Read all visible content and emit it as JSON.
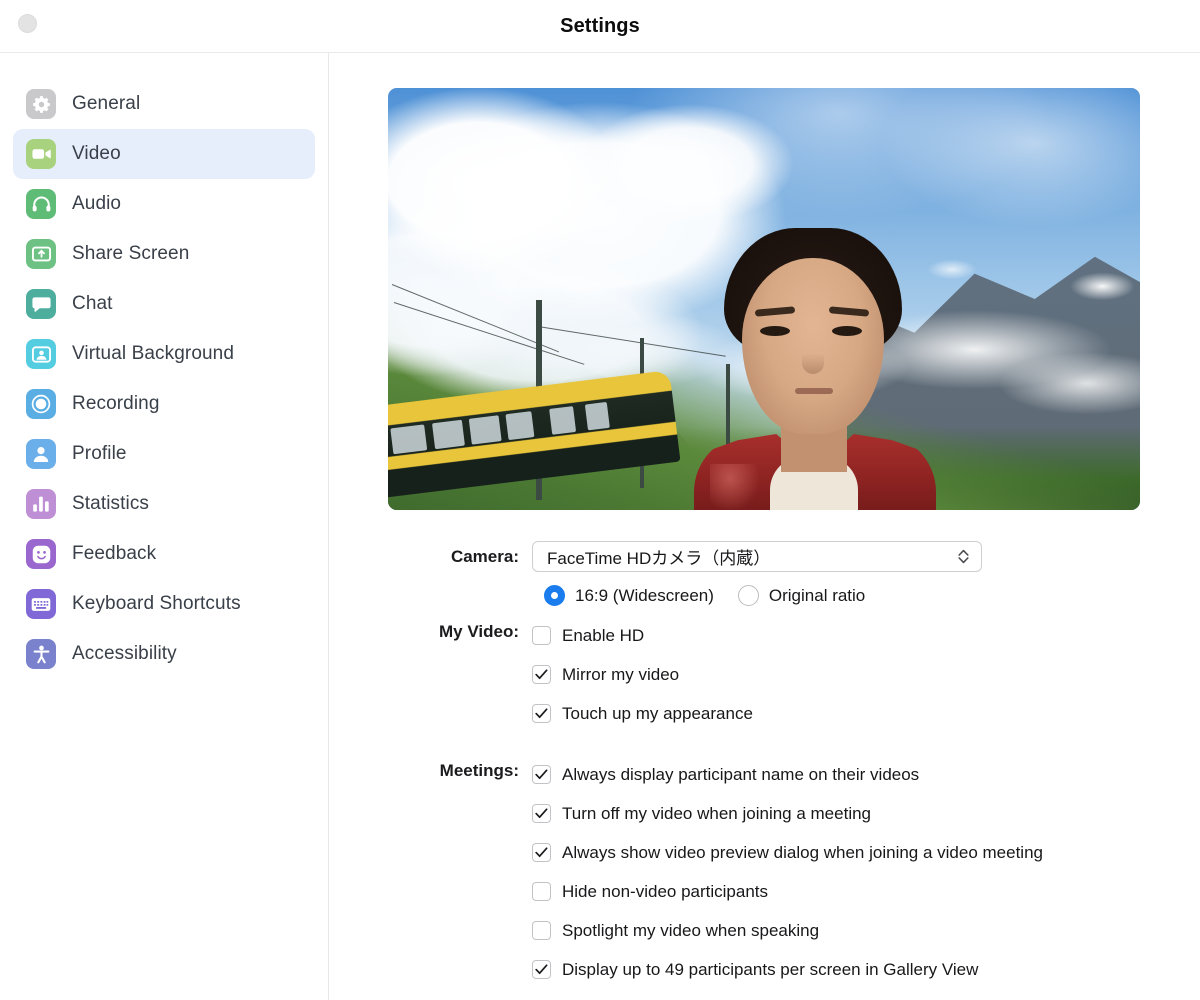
{
  "window": {
    "title": "Settings",
    "close_button": "close-window-button"
  },
  "sidebar": {
    "items": [
      {
        "label": "General",
        "icon": "gear-icon",
        "color": "#c9c9cc",
        "selected": false
      },
      {
        "label": "Video",
        "icon": "video-camera-icon",
        "color": "#a8d27d",
        "selected": true
      },
      {
        "label": "Audio",
        "icon": "headphones-icon",
        "color": "#5fbc77",
        "selected": false
      },
      {
        "label": "Share Screen",
        "icon": "share-screen-icon",
        "color": "#6dc183",
        "selected": false
      },
      {
        "label": "Chat",
        "icon": "chat-bubble-icon",
        "color": "#4dae9e",
        "selected": false
      },
      {
        "label": "Virtual Background",
        "icon": "virtual-background-icon",
        "color": "#55cde0",
        "selected": false
      },
      {
        "label": "Recording",
        "icon": "record-circle-icon",
        "color": "#5aaee4",
        "selected": false
      },
      {
        "label": "Profile",
        "icon": "person-icon",
        "color": "#6aaeea",
        "selected": false
      },
      {
        "label": "Statistics",
        "icon": "bar-chart-icon",
        "color": "#bf8fd6",
        "selected": false
      },
      {
        "label": "Feedback",
        "icon": "smiley-face-icon",
        "color": "#9a67cf",
        "selected": false
      },
      {
        "label": "Keyboard Shortcuts",
        "icon": "keyboard-icon",
        "color": "#8069d6",
        "selected": false
      },
      {
        "label": "Accessibility",
        "icon": "accessibility-icon",
        "color": "#7a82cd",
        "selected": false
      }
    ]
  },
  "video_settings": {
    "preview": {
      "alt": "camera-preview-person-in-red-jacket-mountain-background"
    },
    "camera": {
      "label": "Camera:",
      "selected": "FaceTime HDカメラ（内蔵）"
    },
    "aspect_ratio": {
      "options": [
        {
          "label": "16:9 (Widescreen)",
          "selected": true
        },
        {
          "label": "Original ratio",
          "selected": false
        }
      ]
    },
    "my_video": {
      "label": "My Video:",
      "checkboxes": [
        {
          "label": "Enable HD",
          "checked": false
        },
        {
          "label": "Mirror my video",
          "checked": true
        },
        {
          "label": "Touch up my appearance",
          "checked": true
        }
      ]
    },
    "meetings": {
      "label": "Meetings:",
      "checkboxes": [
        {
          "label": "Always display participant name on their videos",
          "checked": true
        },
        {
          "label": "Turn off my video when joining a meeting",
          "checked": true
        },
        {
          "label": "Always show video preview dialog when joining a video meeting",
          "checked": true
        },
        {
          "label": "Hide non-video participants",
          "checked": false
        },
        {
          "label": "Spotlight my video when speaking",
          "checked": false
        },
        {
          "label": "Display up to 49 participants per screen in Gallery View",
          "checked": true
        }
      ]
    }
  },
  "colors": {
    "accent_blue": "#1a7ced",
    "selected_row_bg": "#e7eefb",
    "text_primary": "#18181a",
    "text_sidebar": "#3a4049"
  }
}
